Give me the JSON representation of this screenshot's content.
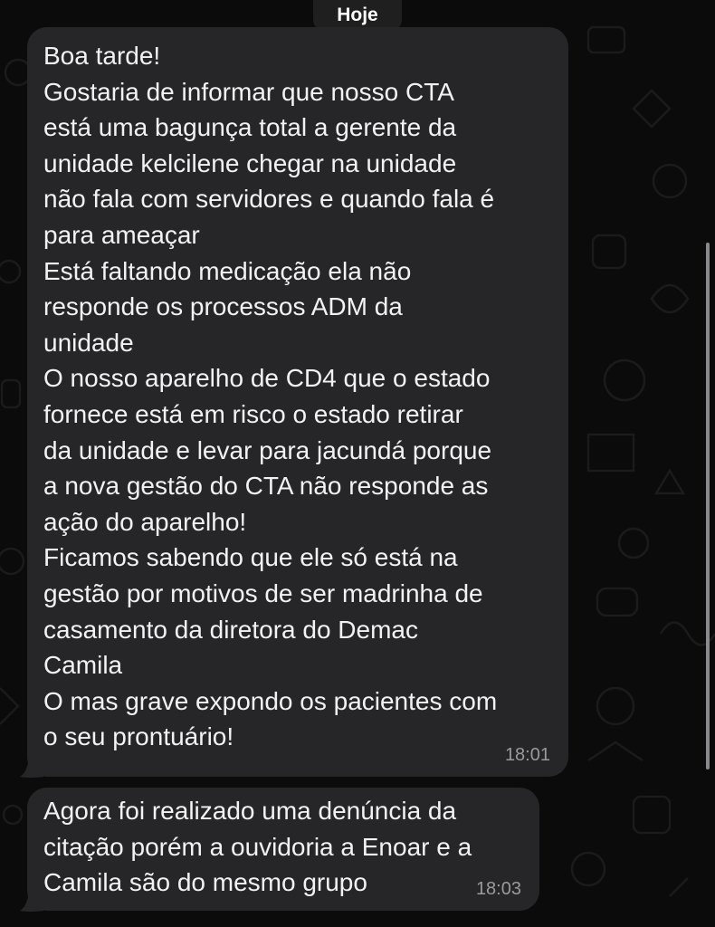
{
  "chat": {
    "date_separator": "Hoje",
    "messages": [
      {
        "text": "Boa tarde!\nGostaria de informar que nosso CTA\nestá uma bagunça total a gerente da\nunidade kelcilene chegar na unidade\nnão fala com servidores e quando fala é\npara ameaçar\nEstá faltando medicação ela não\nresponde os processos ADM da\nunidade\nO nosso aparelho de CD4 que o estado\nfornece está em risco o estado retirar\nda unidade e levar para jacundá porque\na nova gestão do CTA não responde as\nação do aparelho!\nFicamos sabendo que ele só está na\ngestão por motivos de ser madrinha de\ncasamento da diretora do Demac\nCamila\nO mas grave expondo os pacientes com\no seu prontuário!",
        "time": "18:01"
      },
      {
        "text": "Agora foi realizado uma denúncia da\ncitação porém a ouvidoria a Enoar e a\nCamila são do mesmo grupo",
        "time": "18:03"
      }
    ]
  },
  "colors": {
    "background": "#0b0b0b",
    "bubble": "#262628",
    "text": "#f2f2f2",
    "timestamp": "#9a9a9c"
  }
}
